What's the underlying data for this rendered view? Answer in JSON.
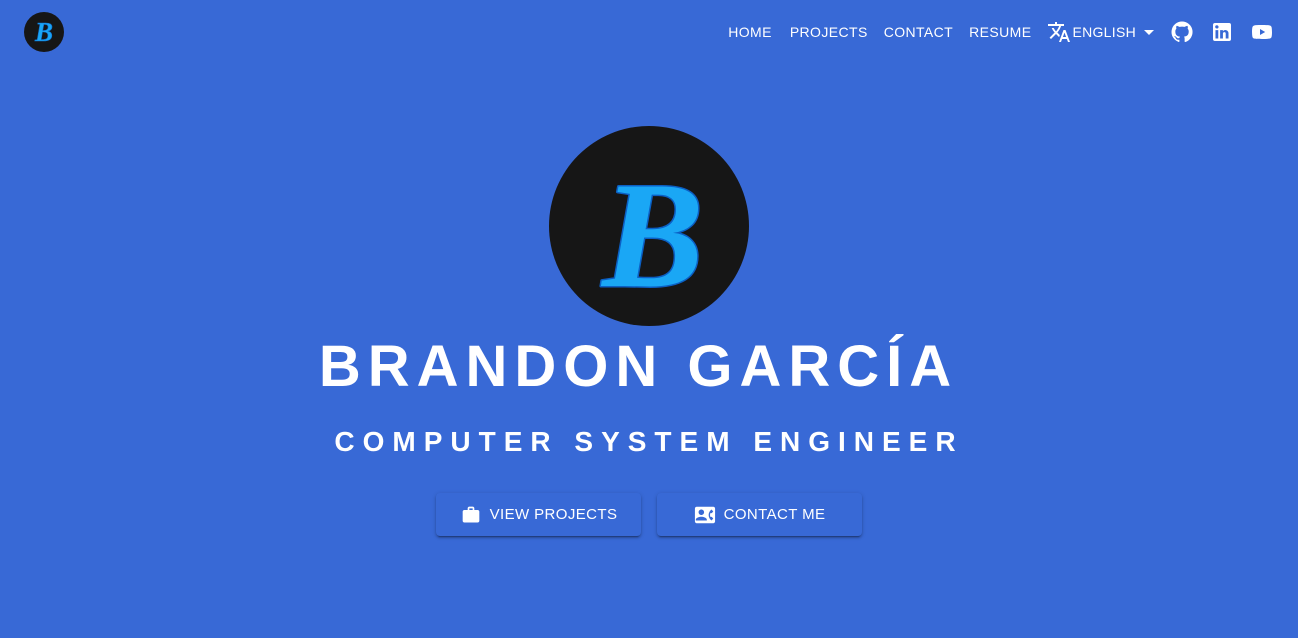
{
  "header": {
    "logo_letter": "B",
    "nav": [
      {
        "label": "HOME"
      },
      {
        "label": "PROJECTS"
      },
      {
        "label": "CONTACT"
      },
      {
        "label": "RESUME"
      }
    ],
    "language": {
      "icon": "translate-icon",
      "selected": "ENGLISH"
    },
    "social": [
      {
        "icon": "github-icon"
      },
      {
        "icon": "linkedin-icon"
      },
      {
        "icon": "youtube-icon"
      }
    ]
  },
  "hero": {
    "logo_letter": "B",
    "name": "BRANDON GARCÍA",
    "title": "COMPUTER SYSTEM ENGINEER",
    "buttons": [
      {
        "label": "VIEW PROJECTS",
        "icon": "briefcase-icon"
      },
      {
        "label": "CONTACT ME",
        "icon": "contact-card-icon"
      }
    ]
  },
  "colors": {
    "background": "#3869d6",
    "logo_circle": "#161616",
    "logo_letter": "#1aa7f5",
    "text": "#ffffff"
  }
}
